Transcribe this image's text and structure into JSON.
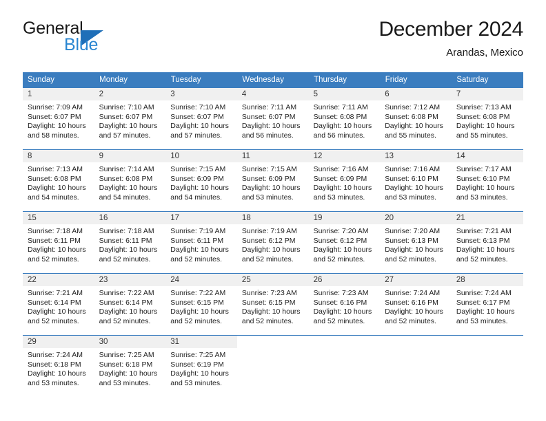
{
  "brand": {
    "line1": "General",
    "line2": "Blue",
    "triangle_color": "#1f6fb8",
    "line2_color": "#2a86d1"
  },
  "header": {
    "title": "December 2024",
    "subtitle": "Arandas, Mexico"
  },
  "theme": {
    "header_blue": "#3b7dbf",
    "daynum_band": "#f0f0f0",
    "text": "#222222"
  },
  "calendar": {
    "weekday_headers": [
      "Sunday",
      "Monday",
      "Tuesday",
      "Wednesday",
      "Thursday",
      "Friday",
      "Saturday"
    ],
    "labels": {
      "sunrise": "Sunrise:",
      "sunset": "Sunset:",
      "daylight": "Daylight:"
    },
    "weeks": [
      [
        {
          "day": "1",
          "sunrise": "Sunrise: 7:09 AM",
          "sunset": "Sunset: 6:07 PM",
          "daylight_line1": "Daylight: 10 hours",
          "daylight_line2": "and 58 minutes."
        },
        {
          "day": "2",
          "sunrise": "Sunrise: 7:10 AM",
          "sunset": "Sunset: 6:07 PM",
          "daylight_line1": "Daylight: 10 hours",
          "daylight_line2": "and 57 minutes."
        },
        {
          "day": "3",
          "sunrise": "Sunrise: 7:10 AM",
          "sunset": "Sunset: 6:07 PM",
          "daylight_line1": "Daylight: 10 hours",
          "daylight_line2": "and 57 minutes."
        },
        {
          "day": "4",
          "sunrise": "Sunrise: 7:11 AM",
          "sunset": "Sunset: 6:07 PM",
          "daylight_line1": "Daylight: 10 hours",
          "daylight_line2": "and 56 minutes."
        },
        {
          "day": "5",
          "sunrise": "Sunrise: 7:11 AM",
          "sunset": "Sunset: 6:08 PM",
          "daylight_line1": "Daylight: 10 hours",
          "daylight_line2": "and 56 minutes."
        },
        {
          "day": "6",
          "sunrise": "Sunrise: 7:12 AM",
          "sunset": "Sunset: 6:08 PM",
          "daylight_line1": "Daylight: 10 hours",
          "daylight_line2": "and 55 minutes."
        },
        {
          "day": "7",
          "sunrise": "Sunrise: 7:13 AM",
          "sunset": "Sunset: 6:08 PM",
          "daylight_line1": "Daylight: 10 hours",
          "daylight_line2": "and 55 minutes."
        }
      ],
      [
        {
          "day": "8",
          "sunrise": "Sunrise: 7:13 AM",
          "sunset": "Sunset: 6:08 PM",
          "daylight_line1": "Daylight: 10 hours",
          "daylight_line2": "and 54 minutes."
        },
        {
          "day": "9",
          "sunrise": "Sunrise: 7:14 AM",
          "sunset": "Sunset: 6:08 PM",
          "daylight_line1": "Daylight: 10 hours",
          "daylight_line2": "and 54 minutes."
        },
        {
          "day": "10",
          "sunrise": "Sunrise: 7:15 AM",
          "sunset": "Sunset: 6:09 PM",
          "daylight_line1": "Daylight: 10 hours",
          "daylight_line2": "and 54 minutes."
        },
        {
          "day": "11",
          "sunrise": "Sunrise: 7:15 AM",
          "sunset": "Sunset: 6:09 PM",
          "daylight_line1": "Daylight: 10 hours",
          "daylight_line2": "and 53 minutes."
        },
        {
          "day": "12",
          "sunrise": "Sunrise: 7:16 AM",
          "sunset": "Sunset: 6:09 PM",
          "daylight_line1": "Daylight: 10 hours",
          "daylight_line2": "and 53 minutes."
        },
        {
          "day": "13",
          "sunrise": "Sunrise: 7:16 AM",
          "sunset": "Sunset: 6:10 PM",
          "daylight_line1": "Daylight: 10 hours",
          "daylight_line2": "and 53 minutes."
        },
        {
          "day": "14",
          "sunrise": "Sunrise: 7:17 AM",
          "sunset": "Sunset: 6:10 PM",
          "daylight_line1": "Daylight: 10 hours",
          "daylight_line2": "and 53 minutes."
        }
      ],
      [
        {
          "day": "15",
          "sunrise": "Sunrise: 7:18 AM",
          "sunset": "Sunset: 6:11 PM",
          "daylight_line1": "Daylight: 10 hours",
          "daylight_line2": "and 52 minutes."
        },
        {
          "day": "16",
          "sunrise": "Sunrise: 7:18 AM",
          "sunset": "Sunset: 6:11 PM",
          "daylight_line1": "Daylight: 10 hours",
          "daylight_line2": "and 52 minutes."
        },
        {
          "day": "17",
          "sunrise": "Sunrise: 7:19 AM",
          "sunset": "Sunset: 6:11 PM",
          "daylight_line1": "Daylight: 10 hours",
          "daylight_line2": "and 52 minutes."
        },
        {
          "day": "18",
          "sunrise": "Sunrise: 7:19 AM",
          "sunset": "Sunset: 6:12 PM",
          "daylight_line1": "Daylight: 10 hours",
          "daylight_line2": "and 52 minutes."
        },
        {
          "day": "19",
          "sunrise": "Sunrise: 7:20 AM",
          "sunset": "Sunset: 6:12 PM",
          "daylight_line1": "Daylight: 10 hours",
          "daylight_line2": "and 52 minutes."
        },
        {
          "day": "20",
          "sunrise": "Sunrise: 7:20 AM",
          "sunset": "Sunset: 6:13 PM",
          "daylight_line1": "Daylight: 10 hours",
          "daylight_line2": "and 52 minutes."
        },
        {
          "day": "21",
          "sunrise": "Sunrise: 7:21 AM",
          "sunset": "Sunset: 6:13 PM",
          "daylight_line1": "Daylight: 10 hours",
          "daylight_line2": "and 52 minutes."
        }
      ],
      [
        {
          "day": "22",
          "sunrise": "Sunrise: 7:21 AM",
          "sunset": "Sunset: 6:14 PM",
          "daylight_line1": "Daylight: 10 hours",
          "daylight_line2": "and 52 minutes."
        },
        {
          "day": "23",
          "sunrise": "Sunrise: 7:22 AM",
          "sunset": "Sunset: 6:14 PM",
          "daylight_line1": "Daylight: 10 hours",
          "daylight_line2": "and 52 minutes."
        },
        {
          "day": "24",
          "sunrise": "Sunrise: 7:22 AM",
          "sunset": "Sunset: 6:15 PM",
          "daylight_line1": "Daylight: 10 hours",
          "daylight_line2": "and 52 minutes."
        },
        {
          "day": "25",
          "sunrise": "Sunrise: 7:23 AM",
          "sunset": "Sunset: 6:15 PM",
          "daylight_line1": "Daylight: 10 hours",
          "daylight_line2": "and 52 minutes."
        },
        {
          "day": "26",
          "sunrise": "Sunrise: 7:23 AM",
          "sunset": "Sunset: 6:16 PM",
          "daylight_line1": "Daylight: 10 hours",
          "daylight_line2": "and 52 minutes."
        },
        {
          "day": "27",
          "sunrise": "Sunrise: 7:24 AM",
          "sunset": "Sunset: 6:16 PM",
          "daylight_line1": "Daylight: 10 hours",
          "daylight_line2": "and 52 minutes."
        },
        {
          "day": "28",
          "sunrise": "Sunrise: 7:24 AM",
          "sunset": "Sunset: 6:17 PM",
          "daylight_line1": "Daylight: 10 hours",
          "daylight_line2": "and 53 minutes."
        }
      ],
      [
        {
          "day": "29",
          "sunrise": "Sunrise: 7:24 AM",
          "sunset": "Sunset: 6:18 PM",
          "daylight_line1": "Daylight: 10 hours",
          "daylight_line2": "and 53 minutes."
        },
        {
          "day": "30",
          "sunrise": "Sunrise: 7:25 AM",
          "sunset": "Sunset: 6:18 PM",
          "daylight_line1": "Daylight: 10 hours",
          "daylight_line2": "and 53 minutes."
        },
        {
          "day": "31",
          "sunrise": "Sunrise: 7:25 AM",
          "sunset": "Sunset: 6:19 PM",
          "daylight_line1": "Daylight: 10 hours",
          "daylight_line2": "and 53 minutes."
        },
        {
          "day": "",
          "sunrise": "",
          "sunset": "",
          "daylight_line1": "",
          "daylight_line2": ""
        },
        {
          "day": "",
          "sunrise": "",
          "sunset": "",
          "daylight_line1": "",
          "daylight_line2": ""
        },
        {
          "day": "",
          "sunrise": "",
          "sunset": "",
          "daylight_line1": "",
          "daylight_line2": ""
        },
        {
          "day": "",
          "sunrise": "",
          "sunset": "",
          "daylight_line1": "",
          "daylight_line2": ""
        }
      ]
    ]
  }
}
